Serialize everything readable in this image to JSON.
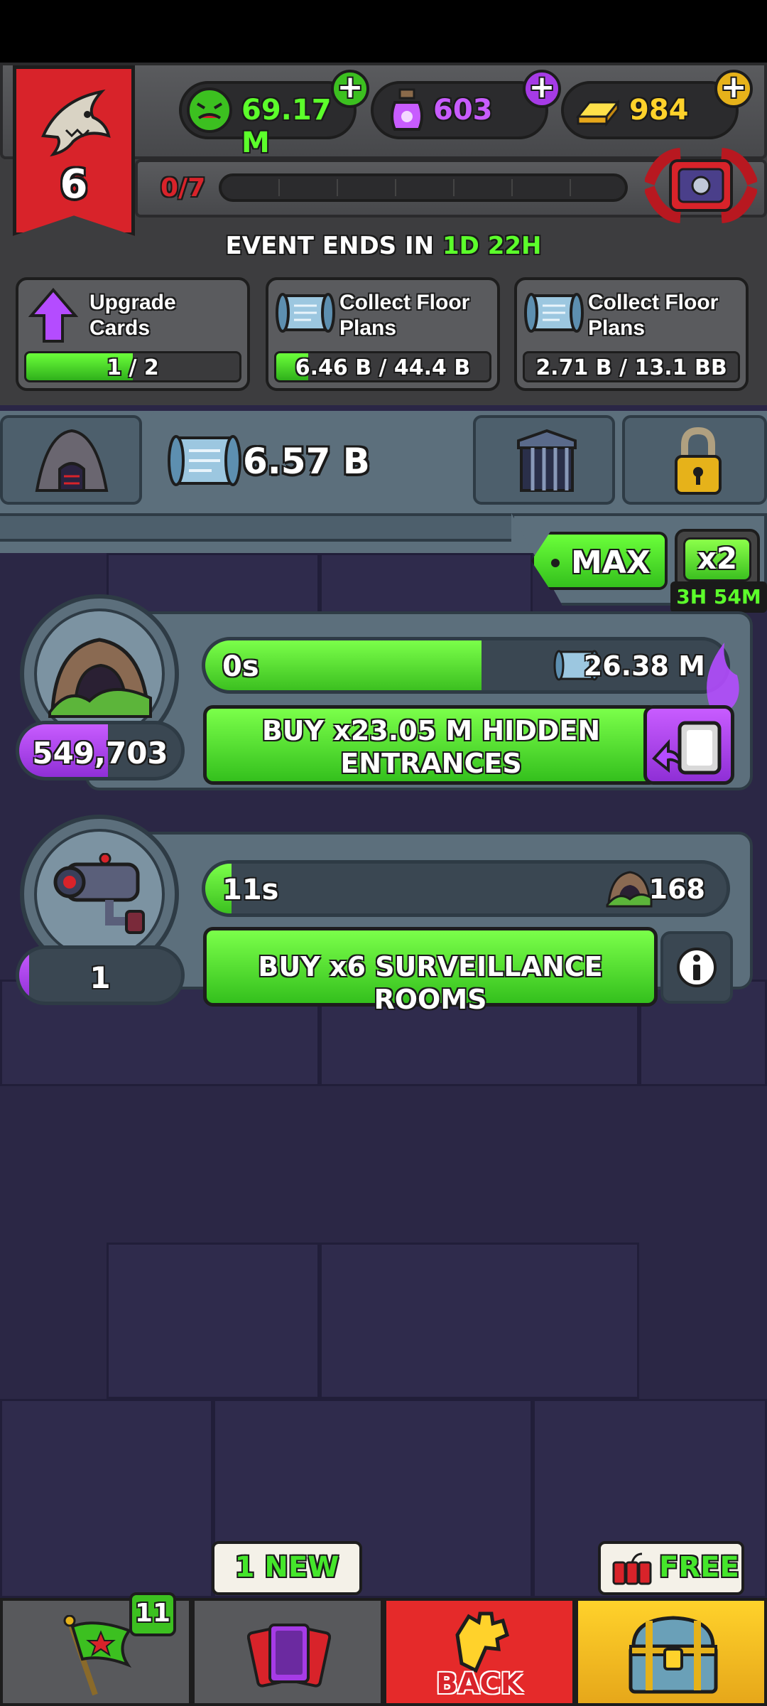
{
  "header": {
    "level": "6",
    "resources": [
      {
        "name": "cash",
        "value": "69.17 M",
        "icon": "monster-coin-icon",
        "color": "#5cff2b"
      },
      {
        "name": "potions",
        "value": "603",
        "icon": "potion-jar-icon",
        "color": "#c85cff"
      },
      {
        "name": "gold",
        "value": "984",
        "icon": "gold-bar-icon",
        "color": "#ffd22b"
      }
    ],
    "xp_progress": "0/7",
    "event": {
      "label": "EVENT ENDS IN ",
      "days": "1D",
      "hours": "22H"
    },
    "tasks": [
      {
        "title_line1": "Upgrade",
        "title_line2": "Cards",
        "value": "1 / 2",
        "progress": 0.5,
        "icon": "up-arrow-icon"
      },
      {
        "title_line1": "Collect Floor",
        "title_line2": "Plans",
        "value": "6.46 B / 44.4 B",
        "progress": 0.15,
        "icon": "blueprint-icon"
      },
      {
        "title_line1": "Collect Floor",
        "title_line2": "Plans",
        "value": "2.71 B / 13.1 BB",
        "progress": 0.0,
        "icon": "blueprint-icon"
      }
    ]
  },
  "tabs": {
    "active_value": "6.57 B"
  },
  "multiplier": {
    "max_label": "MAX",
    "boost_label": "x2",
    "boost_timer": "3H 54M"
  },
  "generators": [
    {
      "count": "549,703",
      "count_fill": 0.55,
      "timer": "0s",
      "timer_fill": 0.6,
      "yield": "26.38 M",
      "buy_line1": "BUY x23.05 M HIDDEN",
      "buy_line2": "ENTRANCES",
      "icon": "cave-entrance-icon"
    },
    {
      "count": "1",
      "count_fill": 0.06,
      "timer": "11s",
      "timer_fill": 0.06,
      "yield": "168",
      "buy_line1": "BUY x6 SURVEILLANCE ROOMS",
      "buy_line2": "",
      "icon": "security-camera-icon"
    }
  ],
  "bottom_nav": {
    "flag_badge": "11",
    "cards_tooltip": "1 NEW",
    "back_label": "BACK",
    "chest_tooltip": "FREE"
  }
}
